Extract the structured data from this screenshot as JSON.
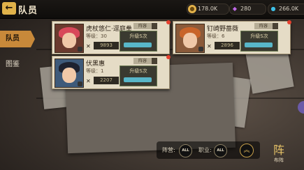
{
  "header": {
    "back_icon": "back-arrow-icon",
    "title": "队员",
    "resources": [
      {
        "icon": "coin-icon",
        "value": "178.0K"
      },
      {
        "icon": "gem-icon",
        "value": "280"
      },
      {
        "icon": "drop-icon",
        "value": "266.0K"
      }
    ]
  },
  "sidebar": {
    "tabs": [
      {
        "label": "队员",
        "active": true
      },
      {
        "label": "图鉴",
        "active": false
      }
    ]
  },
  "roster": {
    "cards": [
      {
        "name": "虎杖悠仁·逕庭拳",
        "level_label": "等级：",
        "level": "30",
        "power": "9893",
        "upgrade_label": "升级S次",
        "slot_label": "阵容",
        "avatar_hair": "#d8485a",
        "avatar_bg": "#6a3a2e"
      },
      {
        "name": "钉崎野蔷薇",
        "level_label": "等级：",
        "level": "6",
        "power": "2896",
        "upgrade_label": "升级S次",
        "slot_label": "阵容",
        "avatar_hair": "#c8642a",
        "avatar_bg": "#8a5a3a"
      },
      {
        "name": "伏黑惠",
        "level_label": "等级：",
        "level": "1",
        "power": "2207",
        "upgrade_label": "升级S次",
        "slot_label": "阵容",
        "avatar_hair": "#1e2230",
        "avatar_bg": "#3e5a7a"
      }
    ]
  },
  "filters": {
    "camp_label": "阵营:",
    "camp_value": "ALL",
    "job_label": "职业:",
    "job_value": "ALL",
    "sort_icon": "double-chevron-up-icon"
  },
  "formation": {
    "glyph": "阵",
    "label": "布阵"
  },
  "colors": {
    "accent": "#c8893a",
    "card_bg": "#e5dcc6",
    "upgrade_bar": "#58b6c8",
    "red_dot": "#e6402e"
  }
}
